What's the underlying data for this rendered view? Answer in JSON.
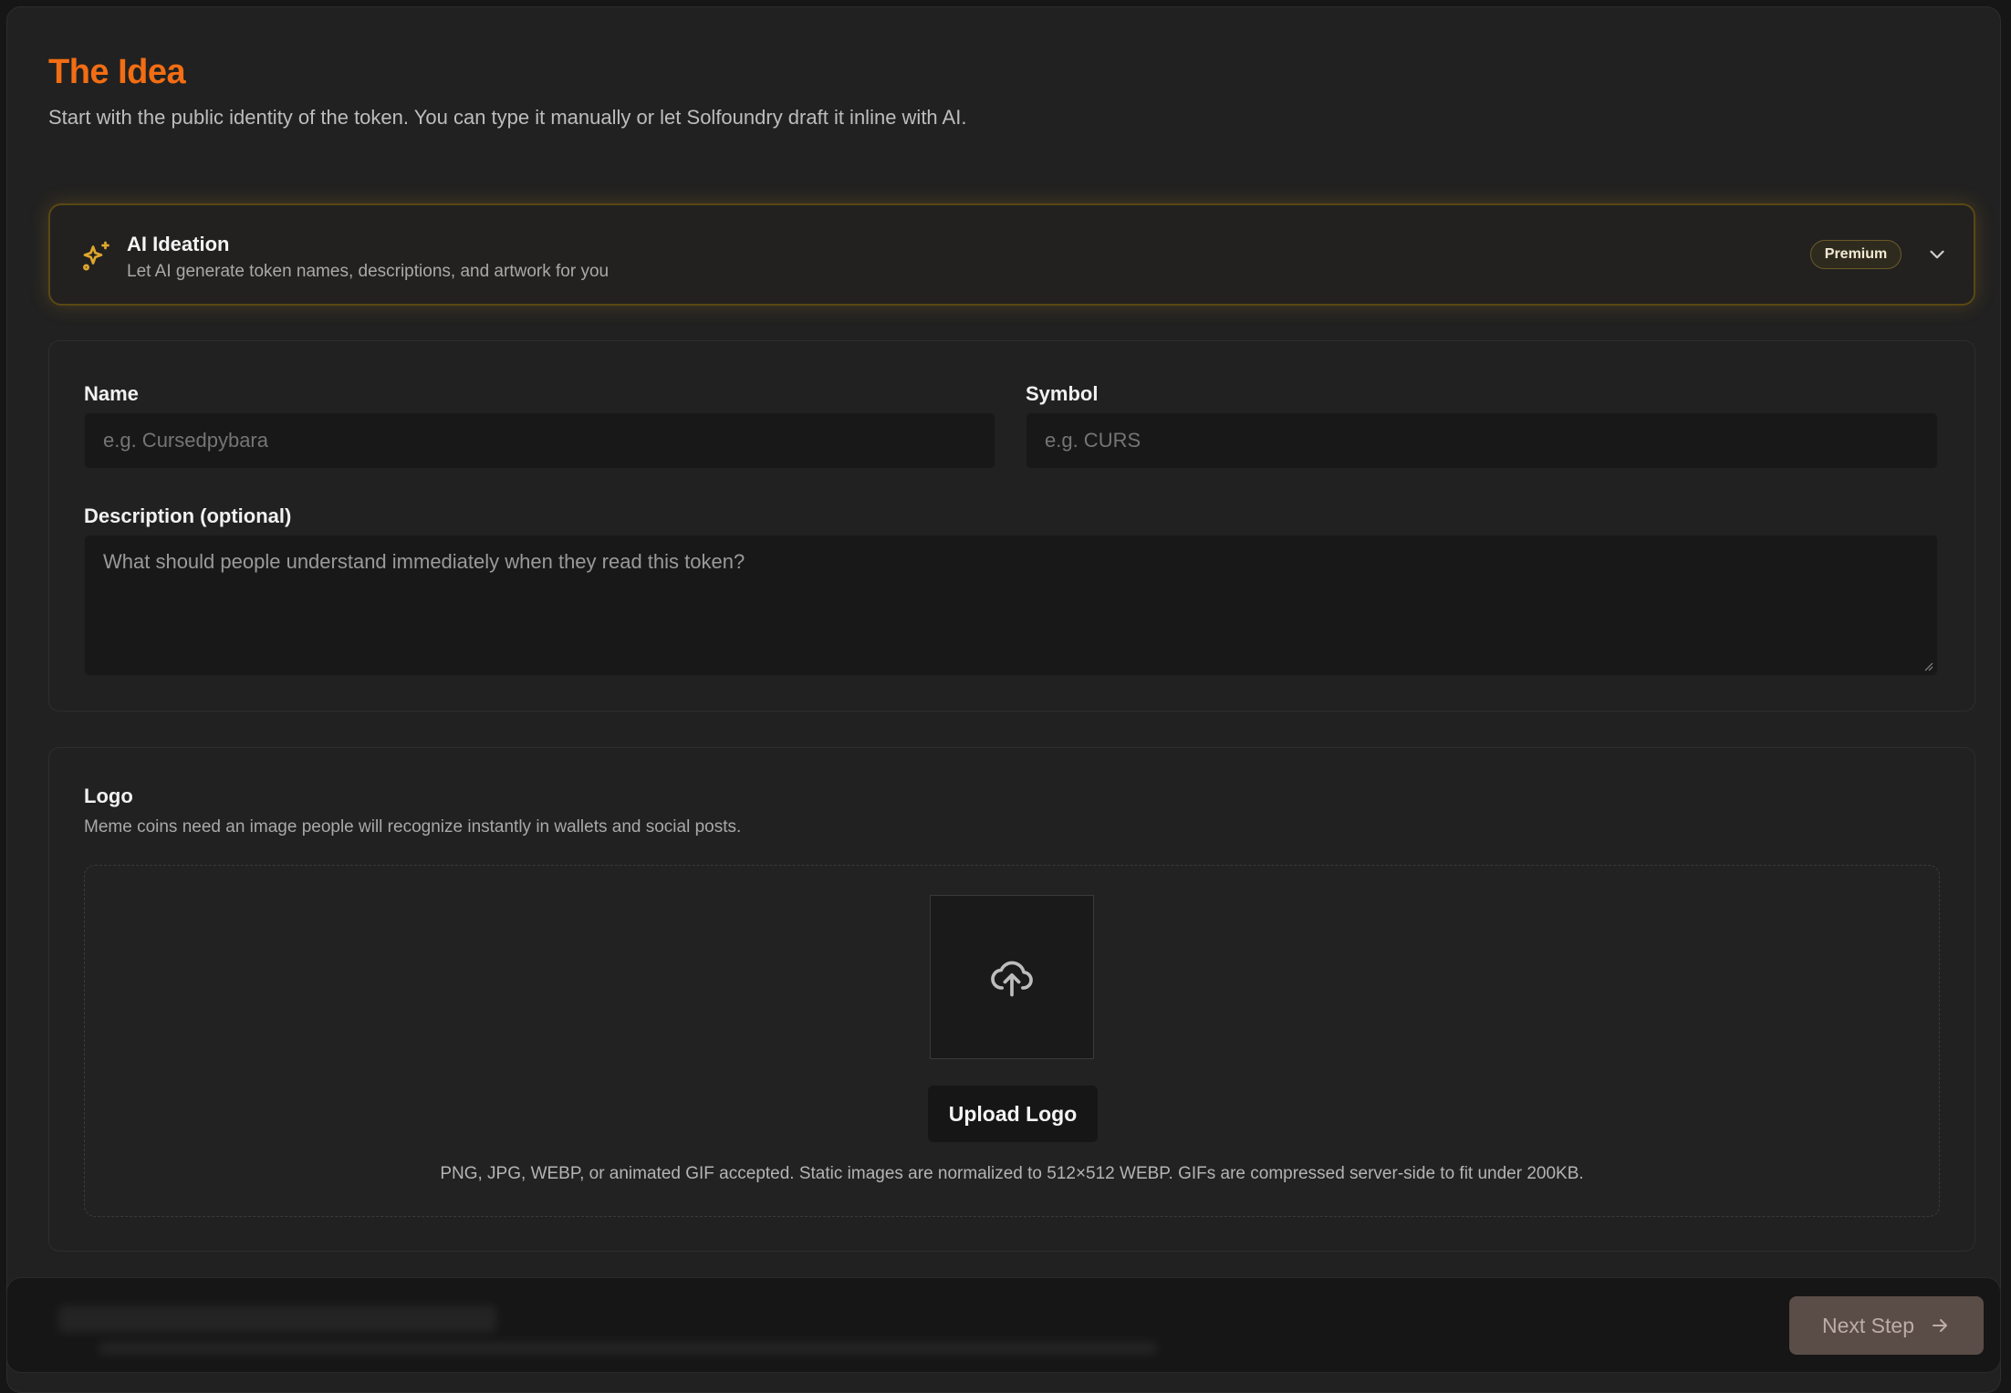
{
  "header": {
    "title": "The Idea",
    "subtitle": "Start with the public identity of the token. You can type it manually or let Solfoundry draft it inline with AI."
  },
  "ai_ideation": {
    "icon": "sparkles-icon",
    "title": "AI Ideation",
    "description": "Let AI generate token names, descriptions, and artwork for you",
    "badge": "Premium",
    "accent_color": "#e0a72b"
  },
  "form": {
    "name": {
      "label": "Name",
      "value": "",
      "placeholder": "e.g. Cursedpybara"
    },
    "symbol": {
      "label": "Symbol",
      "value": "",
      "placeholder": "e.g. CURS"
    },
    "description": {
      "label": "Description (optional)",
      "value": "",
      "placeholder": "What should people understand immediately when they read this token?"
    }
  },
  "logo": {
    "title": "Logo",
    "description": "Meme coins need an image people will recognize instantly in wallets and social posts.",
    "upload_icon": "cloud-upload-icon",
    "upload_label": "Upload Logo",
    "formats_note": "PNG, JPG, WEBP, or animated GIF accepted. Static images are normalized to 512×512 WEBP. GIFs are compressed server-side to fit under 200KB."
  },
  "footer": {
    "next_label": "Next Step",
    "next_icon": "arrow-right-icon"
  },
  "colors": {
    "title_accent": "#f26d13",
    "background": "#212121"
  }
}
